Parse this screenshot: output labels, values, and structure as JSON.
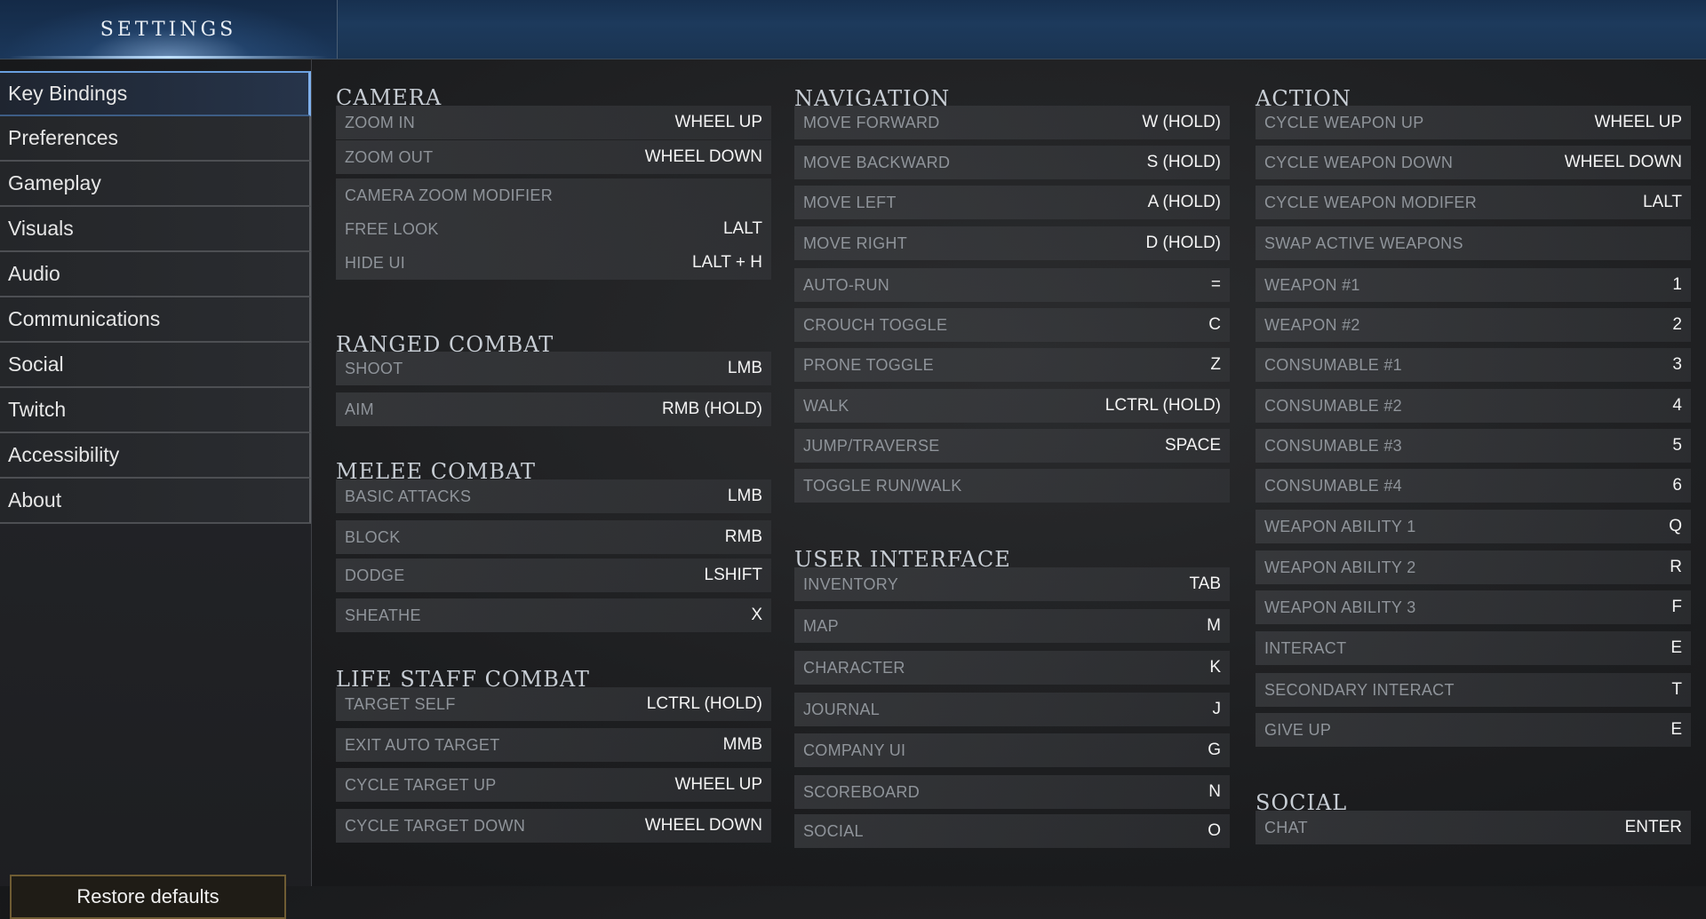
{
  "header": {
    "title": "SETTINGS"
  },
  "sidebar": {
    "items": [
      {
        "label": "Key Bindings",
        "active": true
      },
      {
        "label": "Preferences"
      },
      {
        "label": "Gameplay"
      },
      {
        "label": "Visuals"
      },
      {
        "label": "Audio"
      },
      {
        "label": "Communications"
      },
      {
        "label": "Social"
      },
      {
        "label": "Twitch"
      },
      {
        "label": "Accessibility"
      },
      {
        "label": "About"
      }
    ],
    "restore_label": "Restore defaults"
  },
  "columns": [
    {
      "sections": [
        {
          "title": "CAMERA",
          "rows": [
            {
              "action": "ZOOM IN",
              "key": "WHEEL UP"
            },
            {
              "action": "ZOOM OUT",
              "key": "WHEEL DOWN"
            },
            {
              "action": "CAMERA ZOOM MODIFIER",
              "key": ""
            },
            {
              "action": "FREE LOOK",
              "key": "LALT"
            },
            {
              "action": "HIDE UI",
              "key": "LALT + H"
            }
          ]
        },
        {
          "title": "RANGED COMBAT",
          "rows": [
            {
              "action": "SHOOT",
              "key": "LMB"
            },
            {
              "action": "AIM",
              "key": "RMB (HOLD)"
            }
          ]
        },
        {
          "title": "MELEE COMBAT",
          "rows": [
            {
              "action": "BASIC ATTACKS",
              "key": "LMB"
            },
            {
              "action": "BLOCK",
              "key": "RMB"
            },
            {
              "action": "DODGE",
              "key": "LSHIFT"
            },
            {
              "action": "SHEATHE",
              "key": "X"
            }
          ]
        },
        {
          "title": "LIFE STAFF COMBAT",
          "rows": [
            {
              "action": "TARGET SELF",
              "key": "LCTRL (HOLD)"
            },
            {
              "action": "EXIT AUTO TARGET",
              "key": "MMB"
            },
            {
              "action": "CYCLE TARGET UP",
              "key": "WHEEL UP"
            },
            {
              "action": "CYCLE TARGET DOWN",
              "key": "WHEEL DOWN"
            }
          ]
        }
      ]
    },
    {
      "sections": [
        {
          "title": "NAVIGATION",
          "rows": [
            {
              "action": "MOVE FORWARD",
              "key": "W (HOLD)"
            },
            {
              "action": "MOVE BACKWARD",
              "key": "S (HOLD)"
            },
            {
              "action": "MOVE LEFT",
              "key": "A (HOLD)"
            },
            {
              "action": "MOVE RIGHT",
              "key": "D (HOLD)"
            },
            {
              "action": "AUTO-RUN",
              "key": "="
            },
            {
              "action": "CROUCH TOGGLE",
              "key": "C"
            },
            {
              "action": "PRONE TOGGLE",
              "key": "Z"
            },
            {
              "action": "WALK",
              "key": "LCTRL (HOLD)"
            },
            {
              "action": "JUMP/TRAVERSE",
              "key": "SPACE"
            },
            {
              "action": "TOGGLE RUN/WALK",
              "key": ""
            }
          ]
        },
        {
          "title": "USER INTERFACE",
          "rows": [
            {
              "action": "INVENTORY",
              "key": "TAB"
            },
            {
              "action": "MAP",
              "key": "M"
            },
            {
              "action": "CHARACTER",
              "key": "K"
            },
            {
              "action": "JOURNAL",
              "key": "J"
            },
            {
              "action": "COMPANY UI",
              "key": "G"
            },
            {
              "action": "SCOREBOARD",
              "key": "N"
            },
            {
              "action": "SOCIAL",
              "key": "O"
            }
          ]
        }
      ]
    },
    {
      "sections": [
        {
          "title": "ACTION",
          "rows": [
            {
              "action": "CYCLE WEAPON UP",
              "key": "WHEEL UP"
            },
            {
              "action": "CYCLE WEAPON DOWN",
              "key": "WHEEL DOWN"
            },
            {
              "action": "CYCLE WEAPON MODIFER",
              "key": "LALT"
            },
            {
              "action": "SWAP ACTIVE WEAPONS",
              "key": ""
            },
            {
              "action": "WEAPON #1",
              "key": "1"
            },
            {
              "action": "WEAPON #2",
              "key": "2"
            },
            {
              "action": "CONSUMABLE #1",
              "key": "3"
            },
            {
              "action": "CONSUMABLE #2",
              "key": "4"
            },
            {
              "action": "CONSUMABLE #3",
              "key": "5"
            },
            {
              "action": "CONSUMABLE #4",
              "key": "6"
            },
            {
              "action": "WEAPON ABILITY 1",
              "key": "Q"
            },
            {
              "action": "WEAPON ABILITY 2",
              "key": "R"
            },
            {
              "action": "WEAPON ABILITY 3",
              "key": "F"
            },
            {
              "action": "INTERACT",
              "key": "E"
            },
            {
              "action": "SECONDARY INTERACT",
              "key": "T"
            },
            {
              "action": "GIVE UP",
              "key": "E"
            }
          ]
        },
        {
          "title": "SOCIAL",
          "rows": [
            {
              "action": "CHAT",
              "key": "ENTER"
            }
          ]
        }
      ]
    }
  ]
}
